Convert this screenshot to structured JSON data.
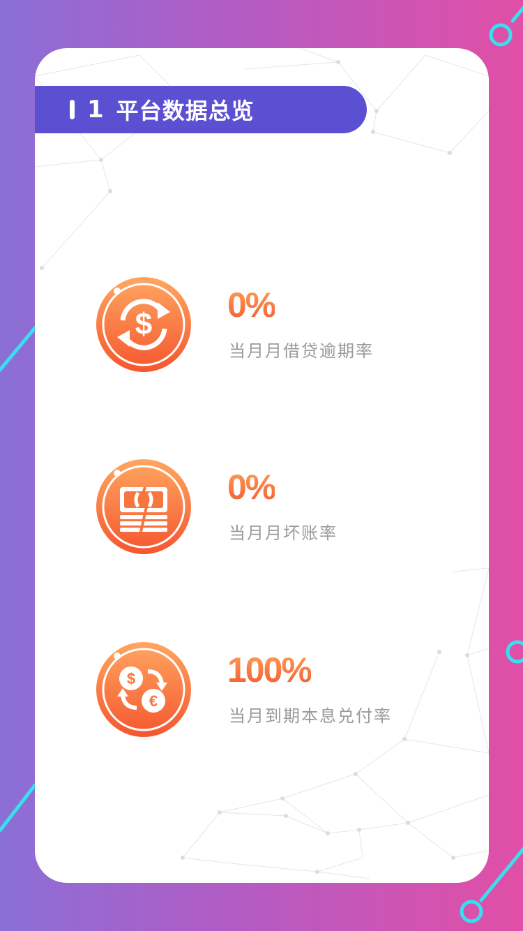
{
  "section": {
    "number": "1",
    "title": "平台数据总览"
  },
  "stats": [
    {
      "value": "0%",
      "label": "当月月借贷逾期率",
      "icon": "dollar-exchange-icon"
    },
    {
      "value": "0%",
      "label": "当月月坏账率",
      "icon": "money-stack-icon"
    },
    {
      "value": "100%",
      "label": "当月到期本息兑付率",
      "icon": "currency-exchange-icon"
    }
  ],
  "colors": {
    "background_start": "#8a6fd6",
    "background_end": "#e14fa6",
    "banner": "#5b4fd2",
    "accent_orange_top": "#ffa056",
    "accent_orange_bottom": "#f25a32",
    "label_gray": "#9a9a9a",
    "deco_cyan": "#38e0ef"
  }
}
